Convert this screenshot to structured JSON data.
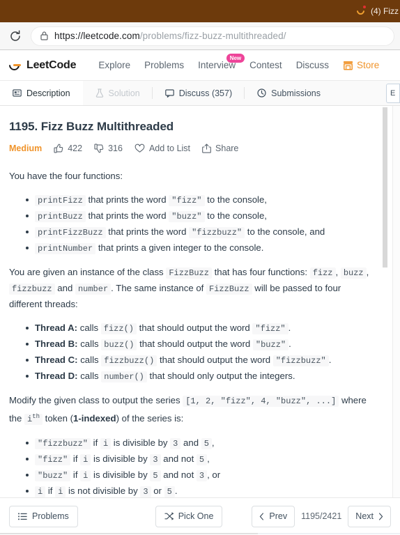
{
  "browser": {
    "tab_title": "(4) Fizz",
    "favicon_icon": "leetcode-favicon",
    "reload_icon": "reload-icon",
    "lock_icon": "lock-icon",
    "url_host": "https://leetcode.com",
    "url_path": "/problems/fizz-buzz-multithreaded/",
    "titlebar_color": "#6d3a0c"
  },
  "nav": {
    "brand": "LeetCode",
    "links": [
      {
        "label": "Explore",
        "badge": ""
      },
      {
        "label": "Problems",
        "badge": ""
      },
      {
        "label": "Interview",
        "badge": "New"
      },
      {
        "label": "Contest",
        "badge": ""
      },
      {
        "label": "Discuss",
        "badge": ""
      }
    ],
    "store_label": "Store",
    "store_icon": "store-icon",
    "store_color": "#f0942b",
    "badge_color": "#ee4499"
  },
  "tabs": [
    {
      "label": "Description",
      "icon": "description-icon",
      "state": "active"
    },
    {
      "label": "Solution",
      "icon": "flask-icon",
      "state": "disabled"
    },
    {
      "label": "Discuss (357)",
      "icon": "comment-icon",
      "state": "normal"
    },
    {
      "label": "Submissions",
      "icon": "clock-icon",
      "state": "normal"
    }
  ],
  "tab_clipped_label": "E",
  "problem": {
    "title": "1195. Fizz Buzz Multithreaded",
    "difficulty": "Medium",
    "difficulty_color": "#f0942b",
    "likes": "422",
    "dislikes": "316",
    "add_to_list_label": "Add to List",
    "share_label": "Share",
    "like_icon": "thumbs-up-icon",
    "dislike_icon": "thumbs-down-icon",
    "list_icon": "heart-icon",
    "share_icon": "share-icon"
  },
  "description": {
    "intro": "You have the four functions:",
    "functions": [
      {
        "code": "printFizz",
        "mid": " that prints the word ",
        "arg": "\"fizz\"",
        "tail": " to the console,"
      },
      {
        "code": "printBuzz",
        "mid": " that prints the word ",
        "arg": "\"buzz\"",
        "tail": " to the console,"
      },
      {
        "code": "printFizzBuzz",
        "mid": " that prints the word ",
        "arg": "\"fizzbuzz\"",
        "tail": " to the console, and"
      },
      {
        "code": "printNumber",
        "mid": " that prints a given integer to the console.",
        "arg": "",
        "tail": ""
      }
    ],
    "instance_p1": "You are given an instance of the class ",
    "instance_class": "FizzBuzz",
    "instance_p2": " that has four functions: ",
    "instance_fns": [
      "fizz",
      "buzz",
      "fizzbuzz",
      "number"
    ],
    "instance_p3": " and ",
    "instance_p4": ". The same instance of ",
    "instance_p5": " will be passed to four different threads:",
    "threads": [
      {
        "name": "Thread A:",
        "calls": " calls ",
        "fn": "fizz()",
        "mid": " that should output the word ",
        "arg": "\"fizz\"",
        "tail": "."
      },
      {
        "name": "Thread B:",
        "calls": " calls ",
        "fn": "buzz()",
        "mid": " that should output the word ",
        "arg": "\"buzz\"",
        "tail": "."
      },
      {
        "name": "Thread C:",
        "calls": " calls ",
        "fn": "fizzbuzz()",
        "mid": " that should output the word ",
        "arg": "\"fizzbuzz\"",
        "tail": "."
      },
      {
        "name": "Thread D:",
        "calls": " calls ",
        "fn": "number()",
        "mid": " that should only output the integers.",
        "arg": "",
        "tail": ""
      }
    ],
    "modify_p1": "Modify the given class to output the series ",
    "modify_series": "[1, 2, \"fizz\", 4, \"buzz\", ...]",
    "modify_p2": " where the ",
    "modify_i": "i",
    "modify_sup": "th",
    "modify_p3": " token (",
    "modify_bold": "1-indexed",
    "modify_p4": ") of the series is:",
    "rules": [
      {
        "token": "\"fizzbuzz\"",
        "t1": " if ",
        "i": "i",
        "t2": " is divisible by ",
        "n1": "3",
        "t3": " and ",
        "n2": "5",
        "t4": ","
      },
      {
        "token": "\"fizz\"",
        "t1": " if ",
        "i": "i",
        "t2": " is divisible by ",
        "n1": "3",
        "t3": " and not ",
        "n2": "5",
        "t4": ","
      },
      {
        "token": "\"buzz\"",
        "t1": " if ",
        "i": "i",
        "t2": " is divisible by ",
        "n1": "5",
        "t3": " and not ",
        "n2": "3",
        "t4": ", or"
      },
      {
        "token": "i",
        "t1": " if ",
        "i": "i",
        "t2": " is not divisible by ",
        "n1": "3",
        "t3": " or ",
        "n2": "5",
        "t4": "."
      }
    ]
  },
  "bottombar": {
    "problems_label": "Problems",
    "problems_icon": "list-icon",
    "pick_one_label": "Pick One",
    "pick_one_icon": "shuffle-icon",
    "prev_label": "Prev",
    "next_label": "Next",
    "counter": "1195/2421"
  }
}
